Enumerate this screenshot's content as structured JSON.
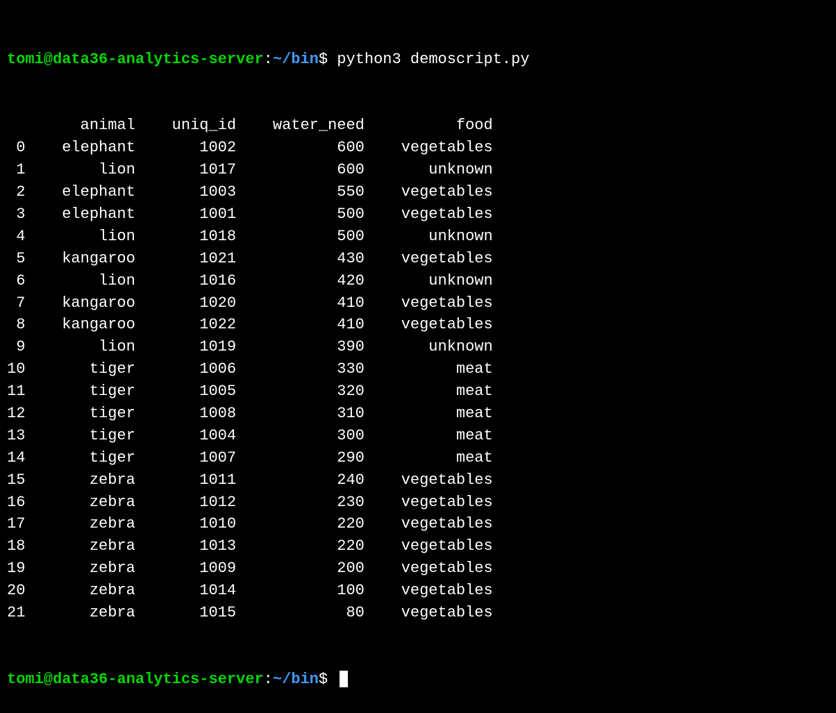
{
  "prompt": {
    "user_host": "tomi@data36-analytics-server",
    "colon": ":",
    "path": "~/bin",
    "dollar": "$ "
  },
  "command": "python3 demoscript.py",
  "chart_data": {
    "type": "table",
    "columns": [
      "animal",
      "uniq_id",
      "water_need",
      "food"
    ],
    "index": [
      0,
      1,
      2,
      3,
      4,
      5,
      6,
      7,
      8,
      9,
      10,
      11,
      12,
      13,
      14,
      15,
      16,
      17,
      18,
      19,
      20,
      21
    ],
    "rows": [
      {
        "animal": "elephant",
        "uniq_id": 1002,
        "water_need": 600,
        "food": "vegetables"
      },
      {
        "animal": "lion",
        "uniq_id": 1017,
        "water_need": 600,
        "food": "unknown"
      },
      {
        "animal": "elephant",
        "uniq_id": 1003,
        "water_need": 550,
        "food": "vegetables"
      },
      {
        "animal": "elephant",
        "uniq_id": 1001,
        "water_need": 500,
        "food": "vegetables"
      },
      {
        "animal": "lion",
        "uniq_id": 1018,
        "water_need": 500,
        "food": "unknown"
      },
      {
        "animal": "kangaroo",
        "uniq_id": 1021,
        "water_need": 430,
        "food": "vegetables"
      },
      {
        "animal": "lion",
        "uniq_id": 1016,
        "water_need": 420,
        "food": "unknown"
      },
      {
        "animal": "kangaroo",
        "uniq_id": 1020,
        "water_need": 410,
        "food": "vegetables"
      },
      {
        "animal": "kangaroo",
        "uniq_id": 1022,
        "water_need": 410,
        "food": "vegetables"
      },
      {
        "animal": "lion",
        "uniq_id": 1019,
        "water_need": 390,
        "food": "unknown"
      },
      {
        "animal": "tiger",
        "uniq_id": 1006,
        "water_need": 330,
        "food": "meat"
      },
      {
        "animal": "tiger",
        "uniq_id": 1005,
        "water_need": 320,
        "food": "meat"
      },
      {
        "animal": "tiger",
        "uniq_id": 1008,
        "water_need": 310,
        "food": "meat"
      },
      {
        "animal": "tiger",
        "uniq_id": 1004,
        "water_need": 300,
        "food": "meat"
      },
      {
        "animal": "tiger",
        "uniq_id": 1007,
        "water_need": 290,
        "food": "meat"
      },
      {
        "animal": "zebra",
        "uniq_id": 1011,
        "water_need": 240,
        "food": "vegetables"
      },
      {
        "animal": "zebra",
        "uniq_id": 1012,
        "water_need": 230,
        "food": "vegetables"
      },
      {
        "animal": "zebra",
        "uniq_id": 1010,
        "water_need": 220,
        "food": "vegetables"
      },
      {
        "animal": "zebra",
        "uniq_id": 1013,
        "water_need": 220,
        "food": "vegetables"
      },
      {
        "animal": "zebra",
        "uniq_id": 1009,
        "water_need": 200,
        "food": "vegetables"
      },
      {
        "animal": "zebra",
        "uniq_id": 1014,
        "water_need": 100,
        "food": "vegetables"
      },
      {
        "animal": "zebra",
        "uniq_id": 1015,
        "water_need": 80,
        "food": "vegetables"
      }
    ]
  },
  "col_widths": {
    "idx": 2,
    "animal": 10,
    "uniq_id": 9,
    "water_need": 12,
    "food": 12
  }
}
